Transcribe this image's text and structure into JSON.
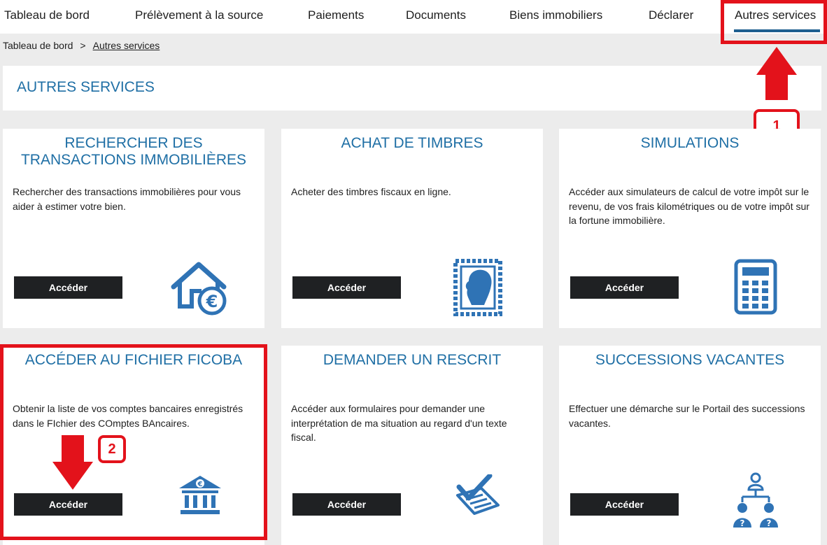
{
  "nav": {
    "items": [
      {
        "label": "Tableau de bord"
      },
      {
        "label": "Prélèvement à la source"
      },
      {
        "label": "Paiements"
      },
      {
        "label": "Documents"
      },
      {
        "label": "Biens immobiliers"
      },
      {
        "label": "Déclarer"
      },
      {
        "label": "Autres services",
        "active": true
      }
    ]
  },
  "breadcrumb": {
    "home": "Tableau de bord",
    "separator": ">",
    "current": "Autres services"
  },
  "page": {
    "title": "AUTRES SERVICES"
  },
  "cards": [
    {
      "title": "RECHERCHER DES TRANSACTIONS IMMOBILIÈRES",
      "description": "Rechercher des transactions immobilières pour vous aider à estimer votre bien.",
      "button": "Accéder",
      "icon": "house-euro-icon"
    },
    {
      "title": "ACHAT DE TIMBRES",
      "description": "Acheter des timbres fiscaux en ligne.",
      "button": "Accéder",
      "icon": "stamp-icon"
    },
    {
      "title": "SIMULATIONS",
      "description": "Accéder aux simulateurs de calcul de votre impôt sur le revenu, de vos frais kilométriques ou de votre impôt sur la fortune immobilière.",
      "button": "Accéder",
      "icon": "calculator-icon"
    },
    {
      "title": "ACCÉDER AU FICHIER FICOBA",
      "description": "Obtenir la liste de vos comptes bancaires enregistrés dans le FIchier des COmptes BAncaires.",
      "button": "Accéder",
      "icon": "bank-euro-icon"
    },
    {
      "title": "DEMANDER UN RESCRIT",
      "description": "Accéder aux formulaires pour demander une interprétation de ma situation au regard d'un texte fiscal.",
      "button": "Accéder",
      "icon": "checked-document-icon"
    },
    {
      "title": "SUCCESSIONS VACANTES",
      "description": "Effectuer une démarche sur le Portail des successions vacantes.",
      "button": "Accéder",
      "icon": "hierarchy-people-icon"
    }
  ],
  "annotations": {
    "step1": "1",
    "step2": "2",
    "color": "#e3121b"
  },
  "colors": {
    "accent": "#1f6fa5",
    "button_bg": "#1f2123",
    "page_bg": "#ececec"
  }
}
